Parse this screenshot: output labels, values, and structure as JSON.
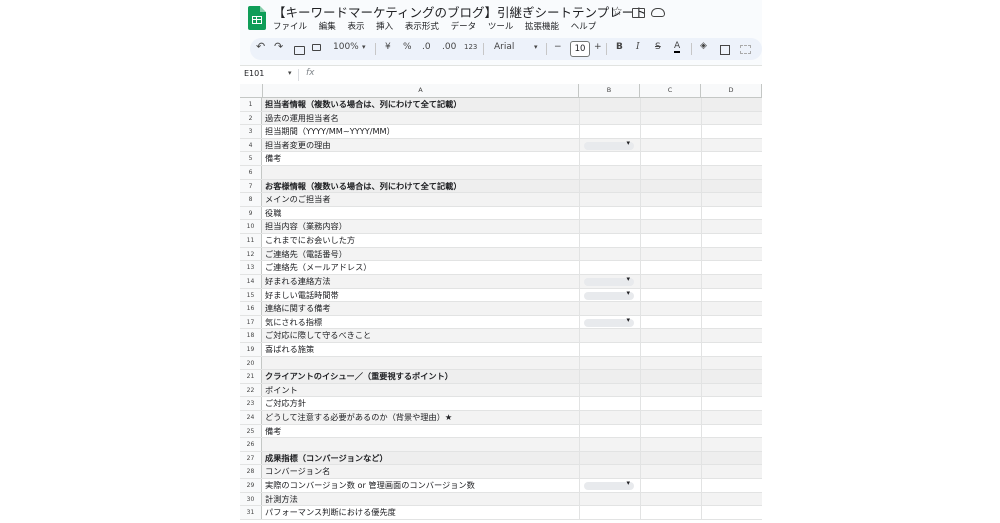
{
  "app": {
    "title": "【キーワードマーケティングのブログ】引継ぎシートテンプレート",
    "menu": [
      "ファイル",
      "編集",
      "表示",
      "挿入",
      "表示形式",
      "データ",
      "ツール",
      "拡張機能",
      "ヘルプ"
    ]
  },
  "toolbar": {
    "zoom": "100%",
    "currency": "¥",
    "percent": "%",
    "dec_decrease": ".0",
    "dec_increase": ".00",
    "format_123": "123",
    "font": "Arial",
    "font_size": "10",
    "minus": "−",
    "plus": "+",
    "bold": "B",
    "italic": "I",
    "strike": "S",
    "text_color": "A"
  },
  "formula_bar": {
    "cell_ref": "E101",
    "fx": "fx"
  },
  "columns": [
    "A",
    "B",
    "C",
    "D"
  ],
  "rows": [
    {
      "n": "1",
      "a": "担当者情報（複数いる場合は、列にわけて全て記載）",
      "header": true,
      "dropdown": false
    },
    {
      "n": "2",
      "a": "過去の運用担当者名",
      "header": false,
      "dropdown": false
    },
    {
      "n": "3",
      "a": "担当期間（YYYY/MM~YYYY/MM）",
      "header": false,
      "dropdown": false
    },
    {
      "n": "4",
      "a": "担当者変更の理由",
      "header": false,
      "dropdown": true
    },
    {
      "n": "5",
      "a": "備考",
      "header": false,
      "dropdown": false
    },
    {
      "n": "6",
      "a": "",
      "header": false,
      "dropdown": false
    },
    {
      "n": "7",
      "a": "お客様情報（複数いる場合は、列にわけて全て記載）",
      "header": true,
      "dropdown": false
    },
    {
      "n": "8",
      "a": "メインのご担当者",
      "header": false,
      "dropdown": false
    },
    {
      "n": "9",
      "a": "役職",
      "header": false,
      "dropdown": false
    },
    {
      "n": "10",
      "a": "担当内容（業務内容）",
      "header": false,
      "dropdown": false
    },
    {
      "n": "11",
      "a": "これまでにお会いした方",
      "header": false,
      "dropdown": false
    },
    {
      "n": "12",
      "a": "ご連絡先（電話番号）",
      "header": false,
      "dropdown": false
    },
    {
      "n": "13",
      "a": "ご連絡先（メールアドレス）",
      "header": false,
      "dropdown": false
    },
    {
      "n": "14",
      "a": "好まれる連絡方法",
      "header": false,
      "dropdown": true
    },
    {
      "n": "15",
      "a": "好ましい電話時間帯",
      "header": false,
      "dropdown": true
    },
    {
      "n": "16",
      "a": "連絡に関する備考",
      "header": false,
      "dropdown": false
    },
    {
      "n": "17",
      "a": "気にされる指標",
      "header": false,
      "dropdown": true
    },
    {
      "n": "18",
      "a": "ご対応に際して守るべきこと",
      "header": false,
      "dropdown": false
    },
    {
      "n": "19",
      "a": "喜ばれる施策",
      "header": false,
      "dropdown": false
    },
    {
      "n": "20",
      "a": "",
      "header": false,
      "dropdown": false
    },
    {
      "n": "21",
      "a": "クライアントのイシュー／（重要視するポイント）",
      "header": true,
      "dropdown": false
    },
    {
      "n": "22",
      "a": "ポイント",
      "header": false,
      "dropdown": false
    },
    {
      "n": "23",
      "a": "ご対応方針",
      "header": false,
      "dropdown": false
    },
    {
      "n": "24",
      "a": "どうして注意する必要があるのか（背景や理由）★",
      "header": false,
      "dropdown": false
    },
    {
      "n": "25",
      "a": "備考",
      "header": false,
      "dropdown": false
    },
    {
      "n": "26",
      "a": "",
      "header": false,
      "dropdown": false
    },
    {
      "n": "27",
      "a": "成果指標（コンバージョンなど）",
      "header": true,
      "dropdown": false
    },
    {
      "n": "28",
      "a": "コンバージョン名",
      "header": false,
      "dropdown": false
    },
    {
      "n": "29",
      "a": "実際のコンバージョン数 or 管理画面のコンバージョン数",
      "header": false,
      "dropdown": true
    },
    {
      "n": "30",
      "a": "計測方法",
      "header": false,
      "dropdown": false
    },
    {
      "n": "31",
      "a": "パフォーマンス判断における優先度",
      "header": false,
      "dropdown": false
    }
  ]
}
